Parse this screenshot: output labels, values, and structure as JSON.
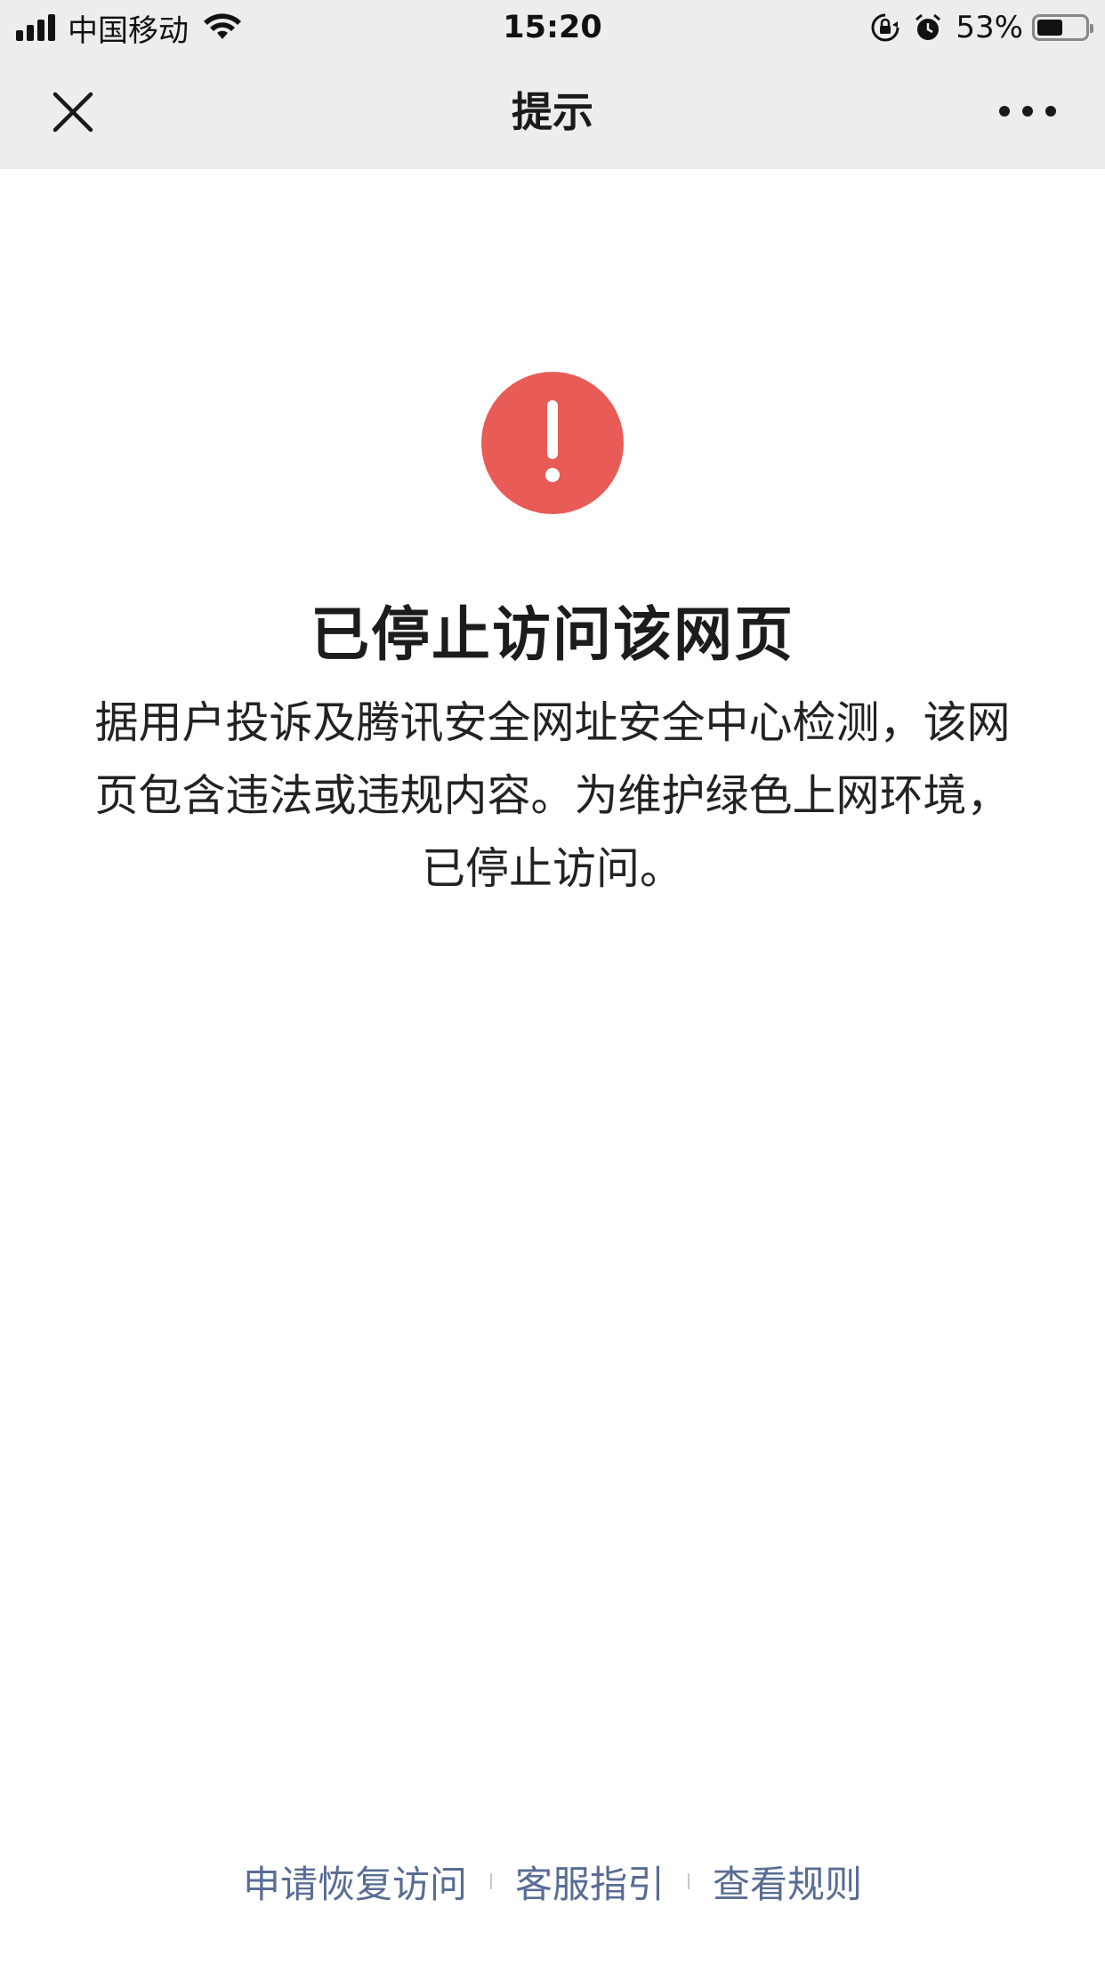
{
  "status_bar": {
    "carrier": "中国移动",
    "time": "15:20",
    "battery_percent": "53%",
    "battery_level": 0.53,
    "icons": [
      "signal-icon",
      "wifi-icon",
      "rotation-lock-icon",
      "alarm-icon",
      "battery-icon"
    ]
  },
  "nav": {
    "title": "提示",
    "close_icon": "close-icon",
    "more_icon": "more-icon"
  },
  "main": {
    "alert_icon": "exclamation-icon",
    "alert_color": "#e85b57",
    "headline": "已停止访问该网页",
    "description": "据用户投诉及腾讯安全网址安全中心检测，该网页包含违法或违规内容。为维护绿色上网环境，已停止访问。"
  },
  "footer": {
    "link_color": "#586c94",
    "links": [
      "申请恢复访问",
      "客服指引",
      "查看规则"
    ]
  }
}
